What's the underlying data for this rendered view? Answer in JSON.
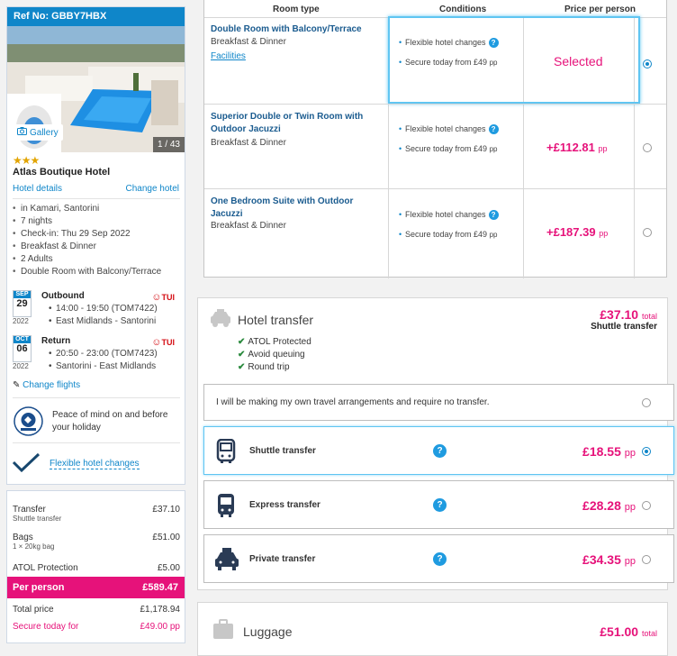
{
  "summary": {
    "ref": "Ref No: GBBY7HBX",
    "gallery": "Gallery",
    "image_count": "1 / 43",
    "stars": "★★★",
    "hotel_name": "Atlas Boutique Hotel",
    "hotel_details": "Hotel details",
    "change_hotel": "Change hotel",
    "items": [
      "in Kamari, Santorini",
      "7 nights",
      "Check-in: Thu 29 Sep 2022",
      "Breakfast & Dinner",
      "2 Adults",
      "Double Room with Balcony/Terrace"
    ],
    "outbound": {
      "month": "SEP",
      "day": "29",
      "year": "2022",
      "title": "Outbound",
      "time": "14:00 - 19:50 (TOM7422)",
      "route": "East Midlands - Santorini",
      "airline": "TUI"
    },
    "return": {
      "month": "OCT",
      "day": "06",
      "year": "2022",
      "title": "Return",
      "time": "20:50 - 23:00 (TOM7423)",
      "route": "Santorini - East Midlands",
      "airline": "TUI"
    },
    "change_flights": "Change flights",
    "peace_of_mind": "Peace of mind on and before your holiday",
    "flexible_changes": "Flexible hotel changes"
  },
  "prices": {
    "transfer_label": "Transfer",
    "transfer_sub": "Shuttle transfer",
    "transfer_value": "£37.10",
    "bags_label": "Bags",
    "bags_sub": "1 × 20kg bag",
    "bags_value": "£51.00",
    "atol_label": "ATOL Protection",
    "atol_value": "£5.00",
    "per_person_label": "Per person",
    "per_person_value": "£589.47",
    "total_label": "Total price",
    "total_value": "£1,178.94",
    "secure_label": "Secure today for",
    "secure_value": "£49.00 pp"
  },
  "rooms": {
    "headers": {
      "type": "Room type",
      "conditions": "Conditions",
      "price": "Price per person"
    },
    "cond_flex": "Flexible hotel changes",
    "cond_secure": "Secure today from £49",
    "cond_pp": "pp",
    "list": [
      {
        "name": "Double Room with Balcony/Terrace",
        "board": "Breakfast & Dinner",
        "facilities": "Facilities",
        "price": "Selected",
        "selected": true
      },
      {
        "name": "Superior Double or Twin Room with Outdoor Jacuzzi",
        "board": "Breakfast & Dinner",
        "price": "+£112.81",
        "pp": "pp",
        "selected": false
      },
      {
        "name": "One Bedroom Suite with Outdoor Jacuzzi",
        "board": "Breakfast & Dinner",
        "price": "+£187.39",
        "pp": "pp",
        "selected": false
      }
    ]
  },
  "transfer": {
    "title": "Hotel transfer",
    "total": "£37.10",
    "total_suffix": "total",
    "subtitle": "Shuttle transfer",
    "checks": [
      "ATOL Protected",
      "Avoid queuing",
      "Round trip"
    ],
    "own_arrangements": "I will be making my own travel arrangements and require no transfer.",
    "options": [
      {
        "label": "Shuttle transfer",
        "price": "£18.55",
        "pp": "pp",
        "selected": true
      },
      {
        "label": "Express transfer",
        "price": "£28.28",
        "pp": "pp",
        "selected": false
      },
      {
        "label": "Private transfer",
        "price": "£34.35",
        "pp": "pp",
        "selected": false
      }
    ]
  },
  "luggage": {
    "title": "Luggage",
    "total": "£51.00",
    "total_suffix": "total"
  },
  "colors": {
    "brand_blue": "#0f86c9",
    "accent_pink": "#e6127a",
    "select_blue": "#5fc5f2"
  }
}
